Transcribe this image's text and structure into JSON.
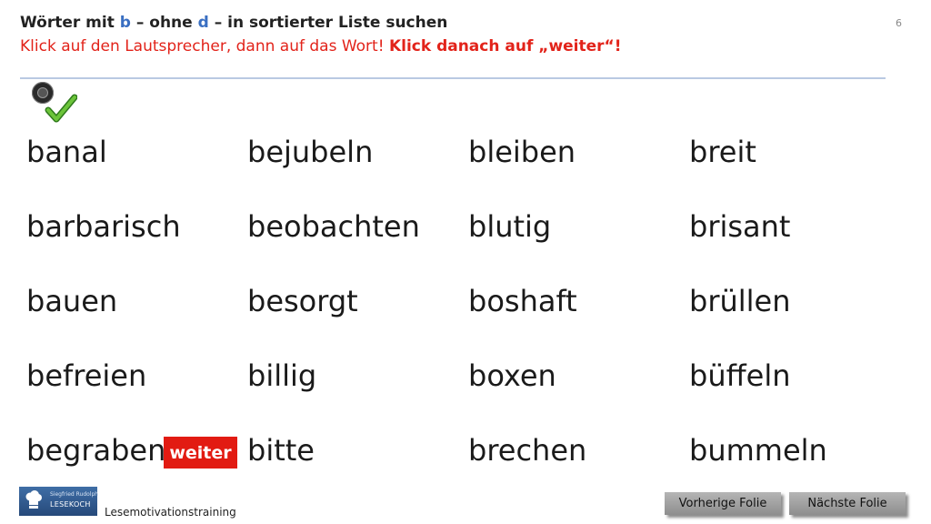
{
  "header": {
    "title": {
      "part1": "Wörter mit ",
      "letter1": "b",
      "part2": " – ohne ",
      "letter2": "d",
      "part3": " – in sortierter Liste suchen"
    },
    "instruction": {
      "normal": "Klick auf den Lautsprecher, dann auf das Wort! ",
      "bold": "Klick danach auf „weiter“!"
    },
    "slide_number": "6"
  },
  "icons": {
    "speaker": "speaker-icon",
    "check": "checkmark-icon"
  },
  "words": {
    "col1": [
      "banal",
      "barbarisch",
      "bauen",
      "befreien",
      "begraben"
    ],
    "col2": [
      "bejubeln",
      "beobachten",
      "besorgt",
      "billig",
      "bitte"
    ],
    "col3": [
      "bleiben",
      "blutig",
      "boshaft",
      "boxen",
      "brechen"
    ],
    "col4": [
      "breit",
      "brisant",
      "brüllen",
      "büffeln",
      "bummeln"
    ]
  },
  "weiter_button": "weiter",
  "footer": {
    "logo_small": "Siegfried Rudolph",
    "logo_main": "LESEKOCH",
    "label": "Lesemotivationstraining",
    "prev": "Vorherige Folie",
    "next": "Nächste Folie"
  },
  "colors": {
    "accent_red": "#e2231a",
    "letter_blue": "#3a6fc2",
    "weiter_bg": "#e21b12",
    "nav_button": "#a3a3a3"
  }
}
